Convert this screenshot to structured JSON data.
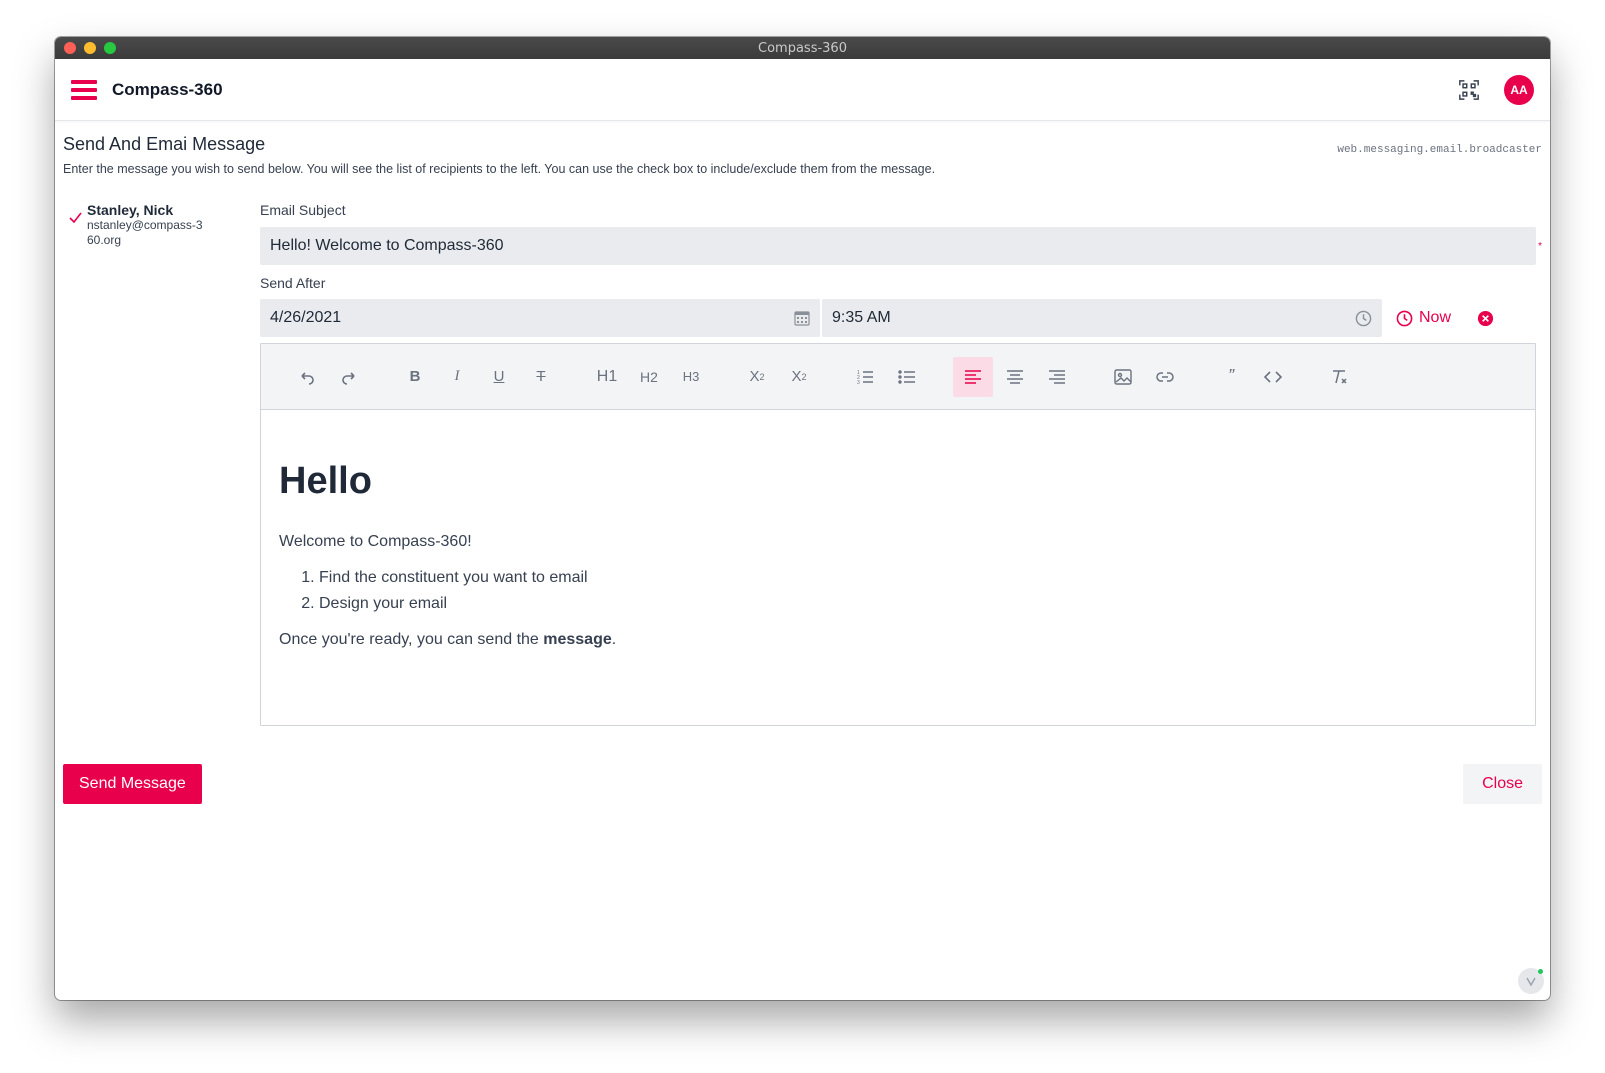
{
  "window": {
    "title": "Compass-360"
  },
  "appbar": {
    "title": "Compass-360",
    "avatar_initials": "AA"
  },
  "page": {
    "route": "web.messaging.email.broadcaster",
    "title": "Send And Emai Message",
    "description": "Enter the message you wish to send below. You will see the list of recipients to the left. You can use the check box to include/exclude them from the message."
  },
  "recipients": [
    {
      "name": "Stanley, Nick",
      "email": "nstanley@compass-360.org",
      "checked": true
    }
  ],
  "form": {
    "subject_label": "Email Subject",
    "subject_value": "Hello! Welcome to Compass-360",
    "required_mark": "*",
    "send_after_label": "Send After",
    "date_value": "4/26/2021",
    "time_value": "9:35 AM",
    "now_label": "Now"
  },
  "toolbar": {
    "h1": "H1",
    "h2": "H2",
    "h3": "H3",
    "bold": "B",
    "italic": "I",
    "underline": "U",
    "strike": "T",
    "subscript": "X",
    "superscript": "X",
    "sub_mark": "2",
    "sup_mark": "2",
    "quote": "”"
  },
  "editor": {
    "heading": "Hello",
    "paragraph1": "Welcome to Compass-360!",
    "list": [
      "Find the constituent you want to email",
      "Design your email"
    ],
    "closing_prefix": "Once you're ready, you can send the ",
    "closing_bold": "message",
    "closing_suffix": "."
  },
  "actions": {
    "send_label": "Send Message",
    "close_label": "Close"
  },
  "colors": {
    "accent": "#e8004c",
    "input_bg": "#e9ebee",
    "toolbar_bg": "#f3f4f6",
    "active_tool_bg": "#fbdbe5"
  }
}
